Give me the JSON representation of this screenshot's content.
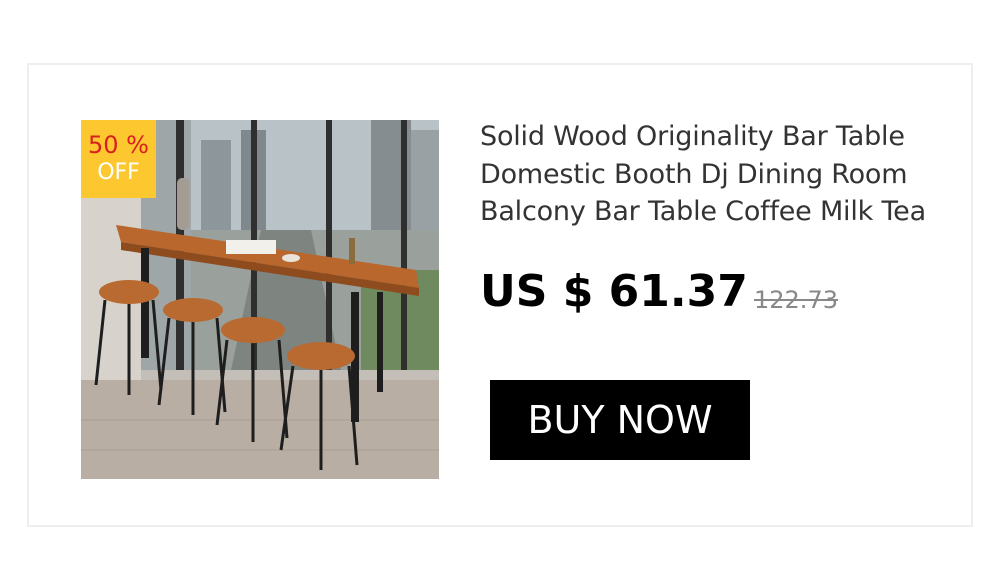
{
  "product": {
    "title": "Solid Wood Originality Bar Table Domestic Booth Dj Dining Room Balcony Bar Table Coffee Milk Tea",
    "price": "US $ 61.37",
    "original_price": "122.73",
    "image_alt": "Wooden bar table with four stools by a window"
  },
  "badge": {
    "line1": "50 %",
    "line2": "OFF",
    "background_color": "#fdc72f",
    "line1_color": "#d82020",
    "line2_color": "#ffffff"
  },
  "cta": {
    "label": "BUY NOW",
    "background_color": "#000000",
    "text_color": "#ffffff"
  }
}
